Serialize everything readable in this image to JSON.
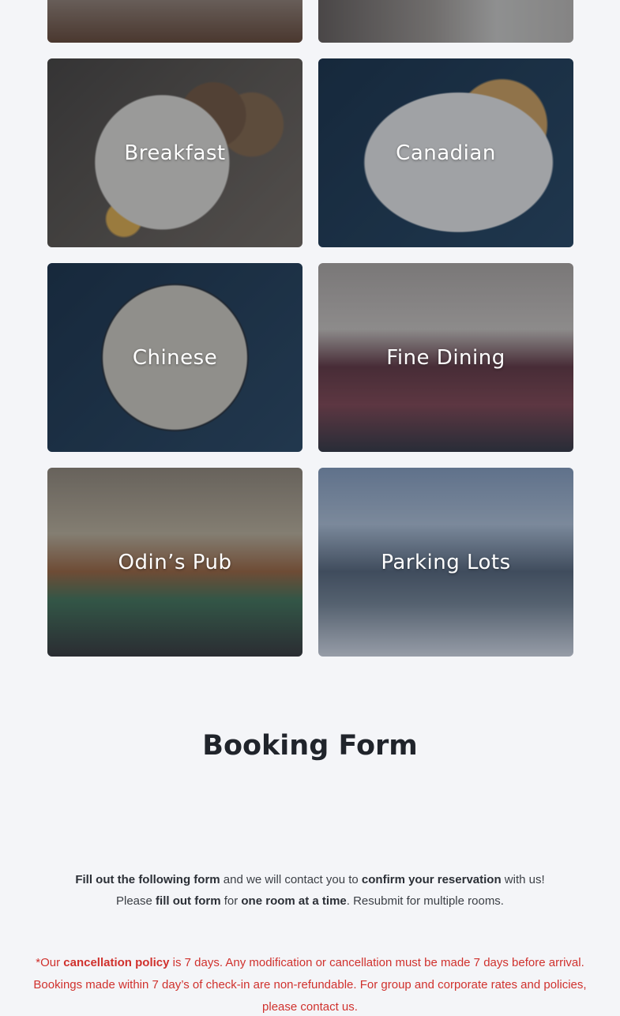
{
  "cards": {
    "breakfast": "Breakfast",
    "canadian": "Canadian",
    "chinese": "Chinese",
    "fine_dining": "Fine Dining",
    "pub": "Odin’s Pub",
    "parking": "Parking Lots"
  },
  "booking": {
    "title": "Booking Form",
    "intro_line1": {
      "b1": "Fill out the following form",
      "t1": " and we will contact you to ",
      "b2": "confirm your reservation",
      "t2": " with us!"
    },
    "intro_line2": {
      "t1": "Please ",
      "b1": "fill out form",
      "t2": " for ",
      "b2": "one room at a time",
      "t3": ". Resubmit for multiple rooms."
    },
    "policy": {
      "t1": "*Our ",
      "b1": "cancellation policy",
      "t2": " is 7 days. Any modification or cancellation must be made 7 days before arrival. Bookings made within 7 day’s of check-in are non-refundable. For group and corporate rates and policies, please contact us."
    }
  },
  "colors": {
    "background": "#f4f5f8",
    "policy_text": "#d0312d",
    "card_label": "#ffffff"
  }
}
